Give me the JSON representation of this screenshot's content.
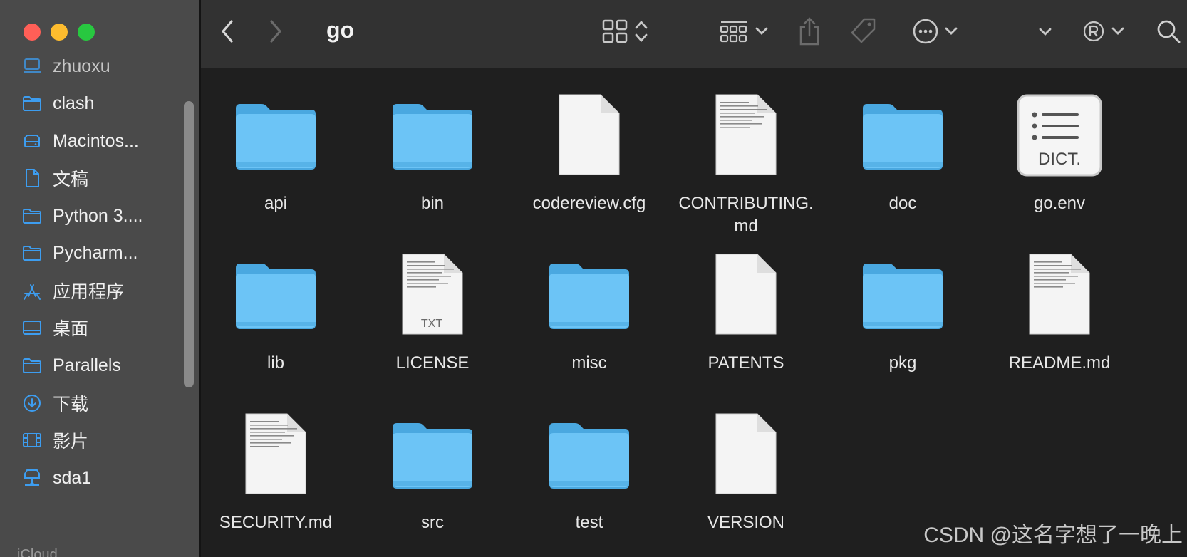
{
  "window": {
    "title": "go"
  },
  "sidebar": {
    "items": [
      {
        "label": "zhuoxu",
        "icon": "computer-icon"
      },
      {
        "label": "clash",
        "icon": "folder-icon"
      },
      {
        "label": "Macintos...",
        "icon": "harddisk-icon"
      },
      {
        "label": "文稿",
        "icon": "document-icon"
      },
      {
        "label": "Python 3....",
        "icon": "folder-icon"
      },
      {
        "label": "Pycharm...",
        "icon": "folder-icon"
      },
      {
        "label": "应用程序",
        "icon": "applications-icon"
      },
      {
        "label": "桌面",
        "icon": "desktop-icon"
      },
      {
        "label": "Parallels",
        "icon": "folder-icon"
      },
      {
        "label": "下载",
        "icon": "download-icon"
      },
      {
        "label": "影片",
        "icon": "film-icon"
      },
      {
        "label": "sda1",
        "icon": "network-drive-icon"
      }
    ],
    "section_label": "iCloud"
  },
  "toolbar": {
    "back_icon": "chevron-left-icon",
    "forward_icon": "chevron-right-icon",
    "view_icon": "grid-view-icon",
    "group_icon": "group-icon",
    "share_icon": "share-icon",
    "tag_icon": "tag-icon",
    "more_icon": "ellipsis-circle-icon",
    "search_icon": "search-icon"
  },
  "files": [
    {
      "name": "api",
      "type": "folder"
    },
    {
      "name": "bin",
      "type": "folder"
    },
    {
      "name": "codereview.cfg",
      "type": "blank-doc"
    },
    {
      "name": "CONTRIBUTING.\nmd",
      "type": "text-doc"
    },
    {
      "name": "doc",
      "type": "folder"
    },
    {
      "name": "go.env",
      "type": "dict",
      "badge": "DICT."
    },
    {
      "name": "lib",
      "type": "folder"
    },
    {
      "name": "LICENSE",
      "type": "txt",
      "badge": "TXT"
    },
    {
      "name": "misc",
      "type": "folder"
    },
    {
      "name": "PATENTS",
      "type": "blank-doc"
    },
    {
      "name": "pkg",
      "type": "folder"
    },
    {
      "name": "README.md",
      "type": "text-doc"
    },
    {
      "name": "SECURITY.md",
      "type": "text-doc"
    },
    {
      "name": "src",
      "type": "folder"
    },
    {
      "name": "test",
      "type": "folder"
    },
    {
      "name": "VERSION",
      "type": "blank-doc"
    }
  ],
  "watermark": "CSDN @这名字想了一晚上",
  "colors": {
    "folder": "#6cc4f6",
    "folder_dark": "#4aa8e0",
    "accent_icon": "#3d9df0"
  }
}
